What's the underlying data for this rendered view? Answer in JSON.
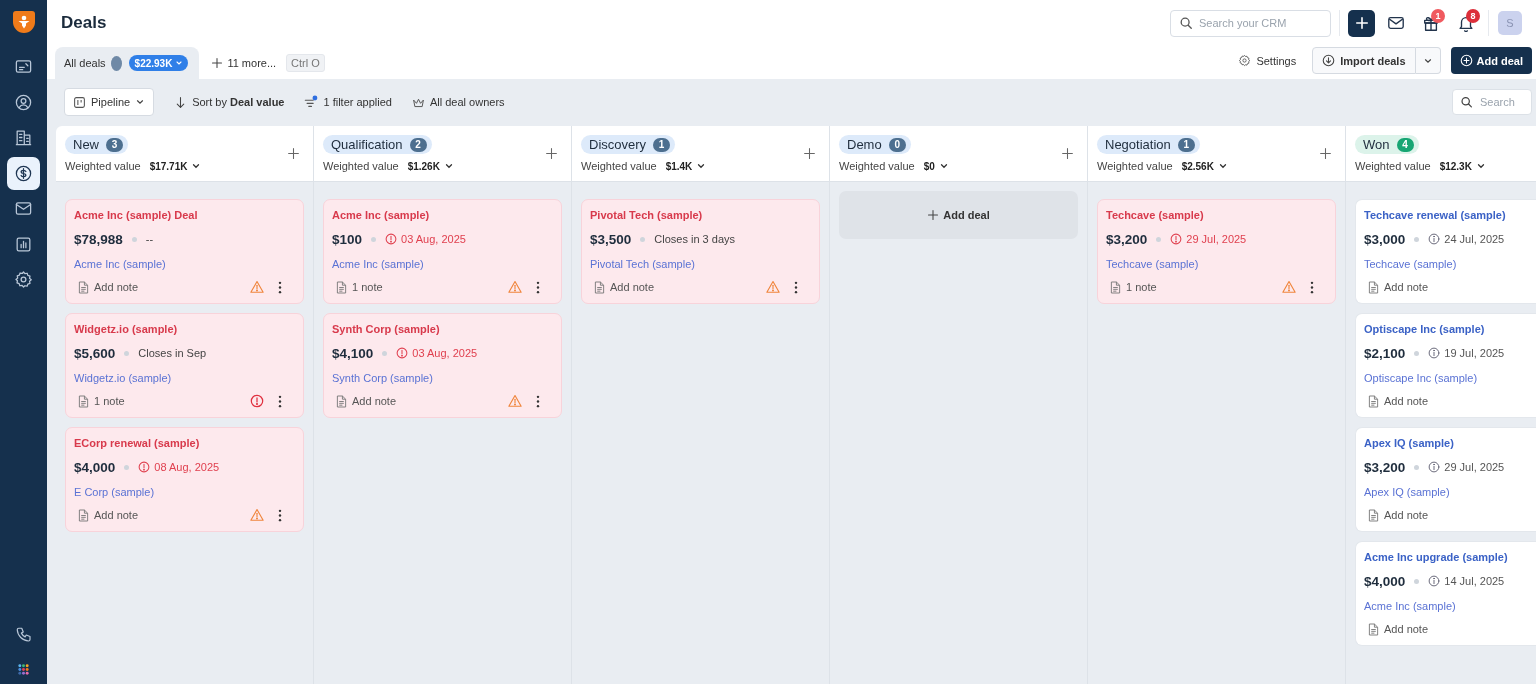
{
  "sidebar": {
    "items": [
      {
        "selected": false
      },
      {
        "selected": false
      },
      {
        "selected": false
      },
      {
        "selected": true
      },
      {
        "selected": false
      },
      {
        "selected": false
      },
      {
        "selected": false
      }
    ]
  },
  "header": {
    "title": "Deals",
    "search": {
      "placeholder": "Search your CRM"
    },
    "gift_badge": "1",
    "bell_badge": "8",
    "avatar": "S"
  },
  "tabs": [
    {
      "label": "All deals",
      "value": "$22.93K",
      "selected": true
    }
  ],
  "more_tabs": {
    "label": "11 more...",
    "shortcut": "Ctrl O"
  },
  "actions": {
    "settings": "Settings",
    "import": "Import deals",
    "add": "Add deal"
  },
  "toolbar": {
    "view": "Pipeline",
    "sort": "Sort by **Deal value**",
    "filter": "1 filter applied",
    "owners": "All deal owners",
    "search": {
      "placeholder": "Search"
    }
  },
  "columns": [
    {
      "name": "New",
      "count": "3",
      "weighted_label": "Weighted value",
      "weighted": "$17.71K",
      "kind": "open",
      "cards": [
        {
          "title": "Acme Inc (sample) Deal",
          "amount": "$78,988",
          "kind": "plain",
          "due": "--",
          "company": "Acme Inc (sample)",
          "note": "Add note",
          "warning": true,
          "error": false,
          "flagged": true
        },
        {
          "title": "Widgetz.io (sample)",
          "amount": "$5,600",
          "kind": "plain",
          "due": "Closes in Sep",
          "company": "Widgetz.io (sample)",
          "note": "1 note",
          "warning": false,
          "error": true,
          "flagged": true
        },
        {
          "title": "ECorp renewal (sample)",
          "amount": "$4,000",
          "kind": "overdue",
          "due": "08 Aug, 2025",
          "company": "E Corp (sample)",
          "note": "Add note",
          "warning": true,
          "error": false,
          "flagged": true
        }
      ]
    },
    {
      "name": "Qualification",
      "count": "2",
      "weighted_label": "Weighted value",
      "weighted": "$1.26K",
      "kind": "open",
      "cards": [
        {
          "title": "Acme Inc (sample)",
          "amount": "$100",
          "kind": "overdue",
          "due": "03 Aug, 2025",
          "company": "Acme Inc (sample)",
          "note": "1 note",
          "warning": true,
          "error": false,
          "flagged": true
        },
        {
          "title": "Synth Corp (sample)",
          "amount": "$4,100",
          "kind": "overdue",
          "due": "03 Aug, 2025",
          "company": "Synth Corp (sample)",
          "note": "Add note",
          "warning": true,
          "error": false,
          "flagged": true
        }
      ]
    },
    {
      "name": "Discovery",
      "count": "1",
      "weighted_label": "Weighted value",
      "weighted": "$1.4K",
      "kind": "open",
      "cards": [
        {
          "title": "Pivotal Tech (sample)",
          "amount": "$3,500",
          "kind": "plain",
          "due": "Closes in 3 days",
          "company": "Pivotal Tech (sample)",
          "note": "Add note",
          "warning": true,
          "error": false,
          "flagged": true
        }
      ]
    },
    {
      "name": "Demo",
      "count": "0",
      "weighted_label": "Weighted value",
      "weighted": "$0",
      "kind": "open",
      "empty_action": "Add deal"
    },
    {
      "name": "Negotiation",
      "count": "1",
      "weighted_label": "Weighted value",
      "weighted": "$2.56K",
      "kind": "open",
      "cards": [
        {
          "title": "Techcave (sample)",
          "amount": "$3,200",
          "kind": "overdue",
          "due": "29 Jul, 2025",
          "company": "Techcave (sample)",
          "note": "1 note",
          "warning": true,
          "error": false,
          "flagged": true
        }
      ]
    },
    {
      "name": "Won",
      "count": "4",
      "weighted_label": "Weighted value",
      "weighted": "$12.3K",
      "kind": "won",
      "cards": [
        {
          "title": "Techcave renewal (sample)",
          "amount": "$3,000",
          "kind": "dated",
          "due": "24 Jul, 2025",
          "company": "Techcave (sample)",
          "note": "Add note",
          "warning": false,
          "error": false,
          "flagged": false
        },
        {
          "title": "Optiscape Inc (sample)",
          "amount": "$2,100",
          "kind": "dated",
          "due": "19 Jul, 2025",
          "company": "Optiscape Inc (sample)",
          "note": "Add note",
          "warning": false,
          "error": false,
          "flagged": false
        },
        {
          "title": "Apex IQ (sample)",
          "amount": "$3,200",
          "kind": "dated",
          "due": "29 Jul, 2025",
          "company": "Apex IQ (sample)",
          "note": "Add note",
          "warning": false,
          "error": false,
          "flagged": false
        },
        {
          "title": "Acme Inc upgrade (sample)",
          "amount": "$4,000",
          "kind": "dated",
          "due": "14 Jul, 2025",
          "company": "Acme Inc (sample)",
          "note": "Add note",
          "warning": false,
          "error": false,
          "flagged": false
        }
      ]
    }
  ]
}
